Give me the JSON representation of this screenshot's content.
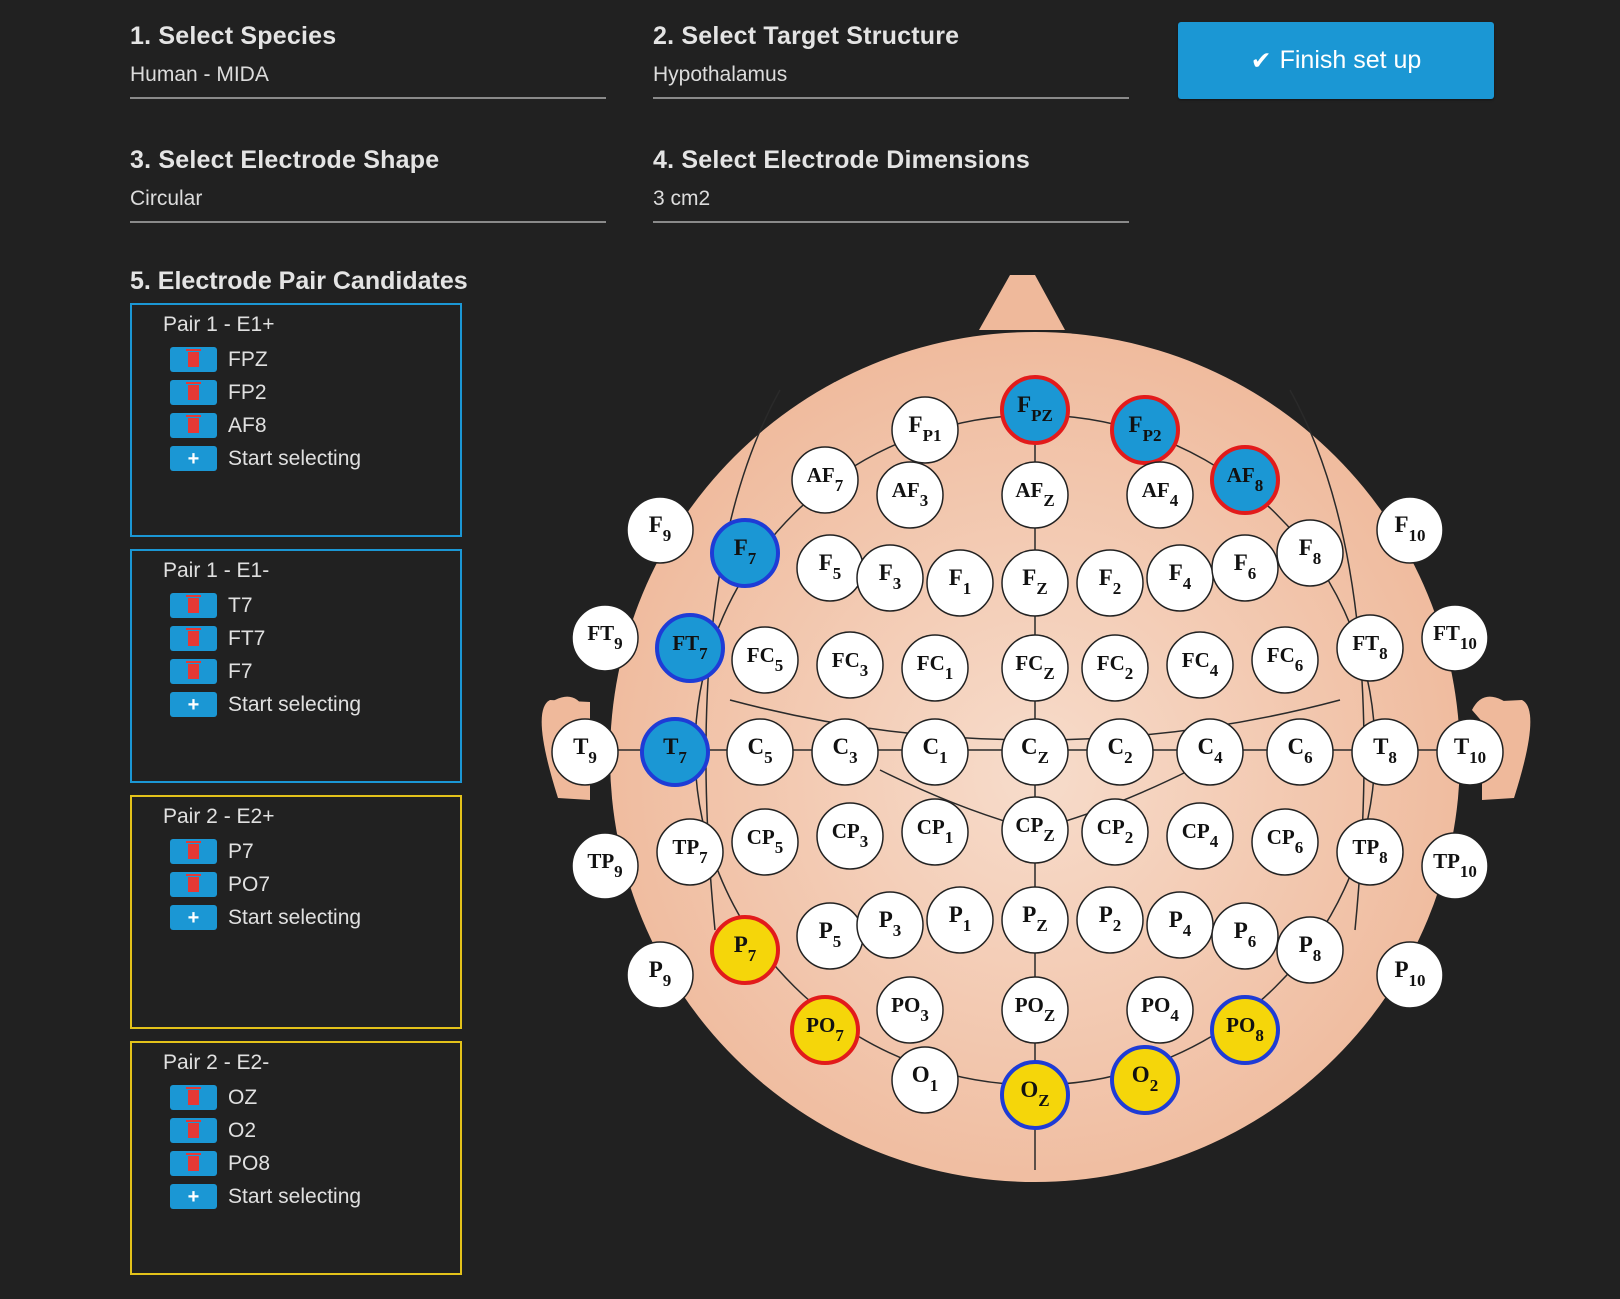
{
  "fields": [
    {
      "label": "1. Select Species",
      "value": "Human - MIDA"
    },
    {
      "label": "2. Select Target Structure",
      "value": "Hypothalamus"
    },
    {
      "label": "3. Select Electrode Shape",
      "value": "Circular"
    },
    {
      "label": "4. Select Electrode Dimensions",
      "value": "3 cm2"
    }
  ],
  "finish_button": {
    "icon": "check-icon",
    "label": "Finish set up"
  },
  "pairs_title": "5. Electrode Pair Candidates",
  "colors": {
    "accent": "#1b97d4",
    "pair2": "#e3c21a",
    "delete": "#e53935",
    "head": "#f3bfa2",
    "selected_blue": "#1b97d4",
    "selected_yellow": "#f5d60a",
    "ring_red": "#e21b1b",
    "ring_blue": "#1e3cd6"
  },
  "pairs": [
    {
      "title": "Pair 1 - E1+",
      "color": "blue",
      "items": [
        "FPZ",
        "FP2",
        "AF8"
      ],
      "add_label": "Start selecting"
    },
    {
      "title": "Pair 1 - E1-",
      "color": "blue",
      "items": [
        "T7",
        "FT7",
        "F7"
      ],
      "add_label": "Start selecting"
    },
    {
      "title": "Pair 2 - E2+",
      "color": "yellow",
      "items": [
        "P7",
        "PO7"
      ],
      "add_label": "Start selecting"
    },
    {
      "title": "Pair 2 - E2-",
      "color": "yellow",
      "items": [
        "OZ",
        "O2",
        "PO8"
      ],
      "add_label": "Start selecting"
    }
  ],
  "electrodes": [
    {
      "b": "F",
      "s": "P1"
    },
    {
      "b": "F",
      "s": "PZ",
      "fill": "blue",
      "ring": "red"
    },
    {
      "b": "F",
      "s": "P2",
      "fill": "blue",
      "ring": "red"
    },
    {
      "b": "AF",
      "s": "7"
    },
    {
      "b": "AF",
      "s": "3"
    },
    {
      "b": "AF",
      "s": "Z"
    },
    {
      "b": "AF",
      "s": "4"
    },
    {
      "b": "AF",
      "s": "8",
      "fill": "blue",
      "ring": "red"
    },
    {
      "b": "F",
      "s": "9"
    },
    {
      "b": "F",
      "s": "7",
      "fill": "blue",
      "ring": "blue"
    },
    {
      "b": "F",
      "s": "5"
    },
    {
      "b": "F",
      "s": "3"
    },
    {
      "b": "F",
      "s": "1"
    },
    {
      "b": "F",
      "s": "Z"
    },
    {
      "b": "F",
      "s": "2"
    },
    {
      "b": "F",
      "s": "4"
    },
    {
      "b": "F",
      "s": "6"
    },
    {
      "b": "F",
      "s": "8"
    },
    {
      "b": "F",
      "s": "10"
    },
    {
      "b": "FT",
      "s": "9"
    },
    {
      "b": "FT",
      "s": "7",
      "fill": "blue",
      "ring": "blue"
    },
    {
      "b": "FC",
      "s": "5"
    },
    {
      "b": "FC",
      "s": "3"
    },
    {
      "b": "FC",
      "s": "1"
    },
    {
      "b": "FC",
      "s": "Z"
    },
    {
      "b": "FC",
      "s": "2"
    },
    {
      "b": "FC",
      "s": "4"
    },
    {
      "b": "FC",
      "s": "6"
    },
    {
      "b": "FT",
      "s": "8"
    },
    {
      "b": "FT",
      "s": "10"
    },
    {
      "b": "T",
      "s": "9"
    },
    {
      "b": "T",
      "s": "7",
      "fill": "blue",
      "ring": "blue"
    },
    {
      "b": "C",
      "s": "5"
    },
    {
      "b": "C",
      "s": "3"
    },
    {
      "b": "C",
      "s": "1"
    },
    {
      "b": "C",
      "s": "Z"
    },
    {
      "b": "C",
      "s": "2"
    },
    {
      "b": "C",
      "s": "4"
    },
    {
      "b": "C",
      "s": "6"
    },
    {
      "b": "T",
      "s": "8"
    },
    {
      "b": "T",
      "s": "10"
    },
    {
      "b": "TP",
      "s": "9"
    },
    {
      "b": "TP",
      "s": "7"
    },
    {
      "b": "CP",
      "s": "5"
    },
    {
      "b": "CP",
      "s": "3"
    },
    {
      "b": "CP",
      "s": "1"
    },
    {
      "b": "CP",
      "s": "Z"
    },
    {
      "b": "CP",
      "s": "2"
    },
    {
      "b": "CP",
      "s": "4"
    },
    {
      "b": "CP",
      "s": "6"
    },
    {
      "b": "TP",
      "s": "8"
    },
    {
      "b": "TP",
      "s": "10"
    },
    {
      "b": "P",
      "s": "9"
    },
    {
      "b": "P",
      "s": "7",
      "fill": "yellow",
      "ring": "red"
    },
    {
      "b": "P",
      "s": "5"
    },
    {
      "b": "P",
      "s": "3"
    },
    {
      "b": "P",
      "s": "1"
    },
    {
      "b": "P",
      "s": "Z"
    },
    {
      "b": "P",
      "s": "2"
    },
    {
      "b": "P",
      "s": "4"
    },
    {
      "b": "P",
      "s": "6"
    },
    {
      "b": "P",
      "s": "8"
    },
    {
      "b": "P",
      "s": "10"
    },
    {
      "b": "PO",
      "s": "7",
      "fill": "yellow",
      "ring": "red"
    },
    {
      "b": "PO",
      "s": "3"
    },
    {
      "b": "PO",
      "s": "Z"
    },
    {
      "b": "PO",
      "s": "4"
    },
    {
      "b": "PO",
      "s": "8",
      "fill": "yellow",
      "ring": "blue"
    },
    {
      "b": "O",
      "s": "1"
    },
    {
      "b": "O",
      "s": "Z",
      "fill": "yellow",
      "ring": "blue"
    },
    {
      "b": "O",
      "s": "2",
      "fill": "yellow",
      "ring": "blue"
    }
  ]
}
